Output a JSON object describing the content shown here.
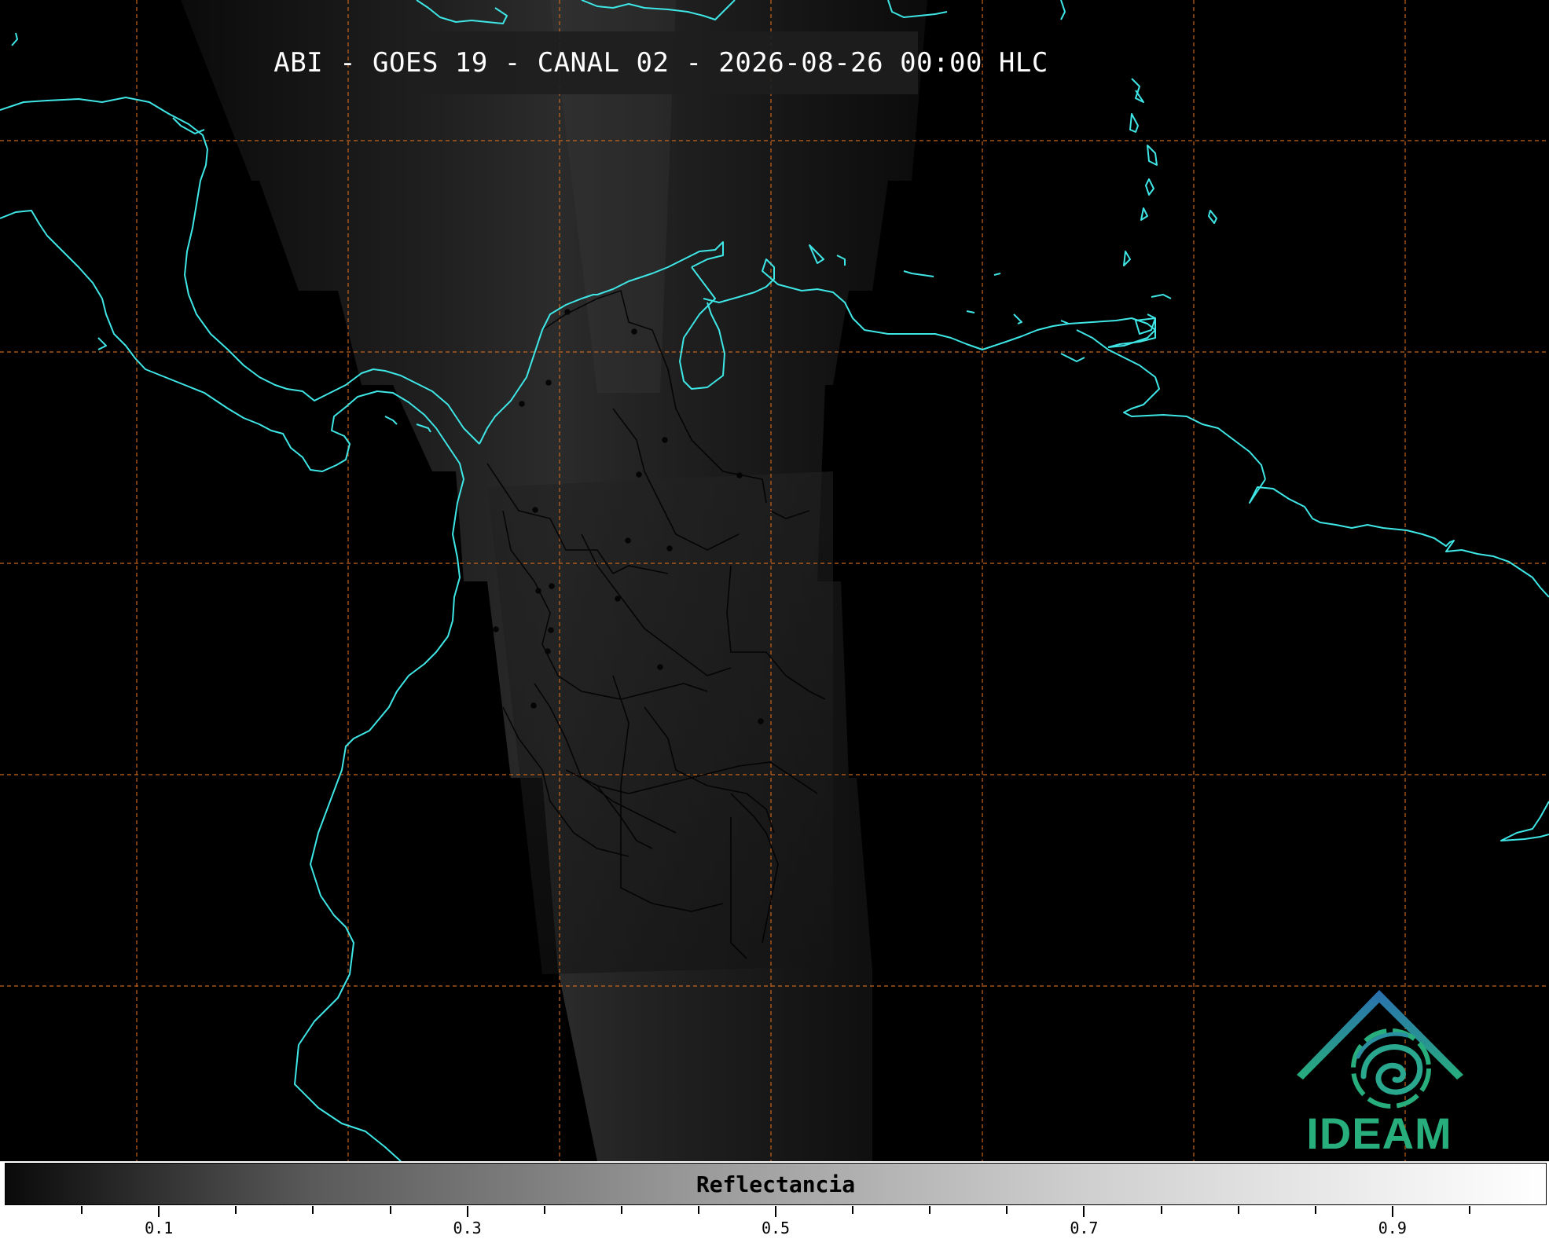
{
  "title": "ABI - GOES 19 - CANAL 02 - 2026-08-26 00:00 HLC",
  "logo": {
    "name": "IDEAM",
    "accent_colors": [
      "#2a6fb0",
      "#27ae7c"
    ]
  },
  "colorbar": {
    "label": "Reflectancia",
    "range": [
      0.0,
      1.0
    ],
    "tick_labels": [
      "0.1",
      "0.3",
      "0.5",
      "0.7",
      "0.9"
    ],
    "tick_values": [
      0.1,
      0.3,
      0.5,
      0.7,
      0.9
    ],
    "minor_step": 0.05,
    "colors": [
      "#000000",
      "#ffffff"
    ]
  },
  "map_style": {
    "coastline_color": "#3fe6e6",
    "grid_color": "#c8641e",
    "grid_style": "dashed",
    "border_color": "#000000"
  }
}
